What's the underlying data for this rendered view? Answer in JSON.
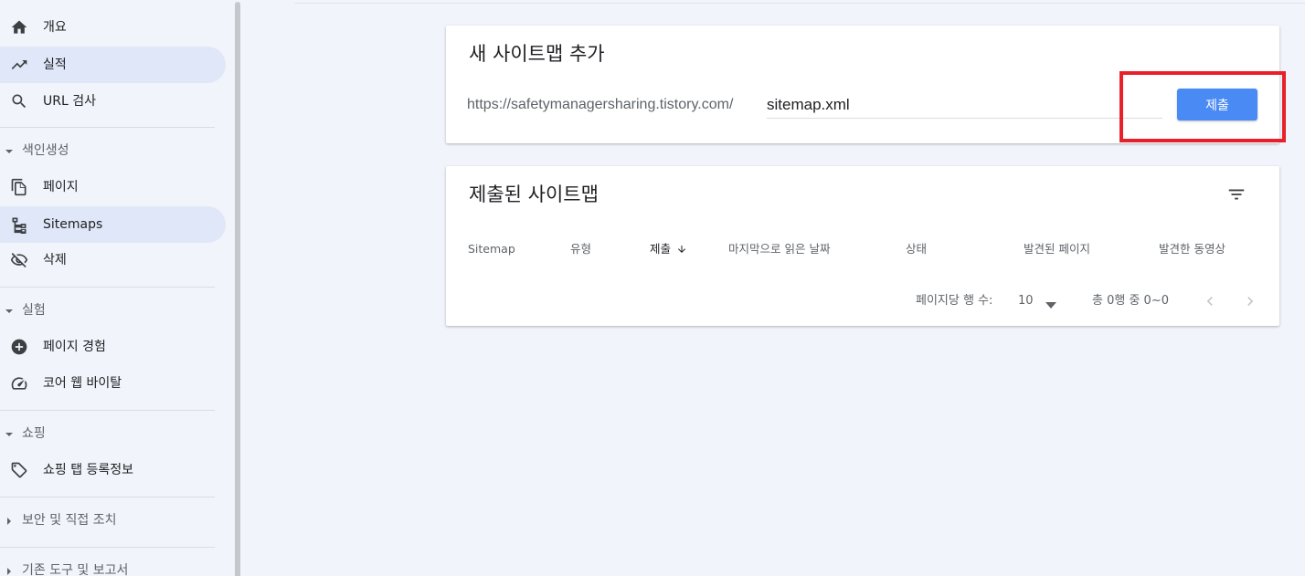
{
  "sidebar": {
    "items": [
      {
        "label": "개요",
        "icon": "home-icon"
      },
      {
        "label": "실적",
        "icon": "trending-up-icon"
      },
      {
        "label": "URL 검사",
        "icon": "search-icon"
      }
    ],
    "sections": [
      {
        "label": "색인생성",
        "items": [
          {
            "label": "페이지",
            "icon": "pages-icon"
          },
          {
            "label": "Sitemaps",
            "icon": "sitemap-icon"
          },
          {
            "label": "삭제",
            "icon": "visibility-off-icon"
          }
        ]
      },
      {
        "label": "실험",
        "items": [
          {
            "label": "페이지 경험",
            "icon": "add-circle-icon"
          },
          {
            "label": "코어 웹 바이탈",
            "icon": "speed-gauge-icon"
          }
        ]
      },
      {
        "label": "쇼핑",
        "items": [
          {
            "label": "쇼핑 탭 등록정보",
            "icon": "tag-icon"
          }
        ]
      },
      {
        "label": "보안 및 직접 조치"
      },
      {
        "label": "기존 도구 및 보고서"
      }
    ]
  },
  "add_card": {
    "title": "새 사이트맵 추가",
    "url_prefix": "https://safetymanagersharing.tistory.com/",
    "input_value": "sitemap.xml",
    "submit_label": "제출"
  },
  "list_card": {
    "title": "제출된 사이트맵",
    "columns": [
      "Sitemap",
      "유형",
      "제출",
      "마지막으로 읽은 날짜",
      "상태",
      "발견된 페이지",
      "발견한 동영상"
    ],
    "rows_per_page_label": "페이지당 행 수:",
    "rows_per_page": "10",
    "range_text": "총 0행 중 0~0"
  },
  "colors": {
    "accent": "#4a8af4",
    "active_nav": "#dfe7f8",
    "highlight": "#e8202a",
    "background": "#f1f4fa"
  }
}
